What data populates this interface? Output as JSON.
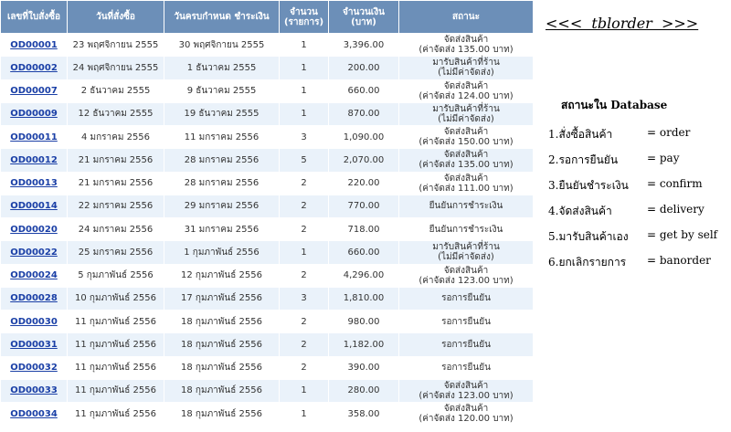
{
  "headers": [
    "เลขที่ใบสั่งซื้อ",
    "วันที่สั่งซื้อ",
    "วันครบกำหนด ชำระเงิน",
    "จำนวน (รายการ)",
    "จำนวนเงิน (บาท)",
    "สถานะ"
  ],
  "rows": [
    {
      "id": "OD00001",
      "order_date": "23 พฤศจิกายน 2555",
      "due_date": "30 พฤศจิกายน 2555",
      "qty": "1",
      "amount": "3,396.00",
      "status": [
        "จัดส่งสินค้า",
        "(ค่าจัดส่ง 135.00 บาท)"
      ]
    },
    {
      "id": "OD00002",
      "order_date": "24 พฤศจิกายน 2555",
      "due_date": "1 ธันวาคม 2555",
      "qty": "1",
      "amount": "200.00",
      "status": [
        "มารับสินค้าที่ร้าน",
        "(ไม่มีค่าจัดส่ง)"
      ]
    },
    {
      "id": "OD00007",
      "order_date": "2 ธันวาคม 2555",
      "due_date": "9 ธันวาคม 2555",
      "qty": "1",
      "amount": "660.00",
      "status": [
        "จัดส่งสินค้า",
        "(ค่าจัดส่ง 124.00 บาท)"
      ]
    },
    {
      "id": "OD00009",
      "order_date": "12 ธันวาคม 2555",
      "due_date": "19 ธันวาคม 2555",
      "qty": "1",
      "amount": "870.00",
      "status": [
        "มารับสินค้าที่ร้าน",
        "(ไม่มีค่าจัดส่ง)"
      ]
    },
    {
      "id": "OD00011",
      "order_date": "4 มกราคม 2556",
      "due_date": "11 มกราคม 2556",
      "qty": "3",
      "amount": "1,090.00",
      "status": [
        "จัดส่งสินค้า",
        "(ค่าจัดส่ง 150.00 บาท)"
      ]
    },
    {
      "id": "OD00012",
      "order_date": "21 มกราคม 2556",
      "due_date": "28 มกราคม 2556",
      "qty": "5",
      "amount": "2,070.00",
      "status": [
        "จัดส่งสินค้า",
        "(ค่าจัดส่ง 135.00 บาท)"
      ]
    },
    {
      "id": "OD00013",
      "order_date": "21 มกราคม 2556",
      "due_date": "28 มกราคม 2556",
      "qty": "2",
      "amount": "220.00",
      "status": [
        "จัดส่งสินค้า",
        "(ค่าจัดส่ง 111.00 บาท)"
      ]
    },
    {
      "id": "OD00014",
      "order_date": "22 มกราคม 2556",
      "due_date": "29 มกราคม 2556",
      "qty": "2",
      "amount": "770.00",
      "status": [
        "ยืนยันการชำระเงิน"
      ]
    },
    {
      "id": "OD00020",
      "order_date": "24 มกราคม 2556",
      "due_date": "31 มกราคม 2556",
      "qty": "2",
      "amount": "718.00",
      "status": [
        "ยืนยันการชำระเงิน"
      ]
    },
    {
      "id": "OD00022",
      "order_date": "25 มกราคม 2556",
      "due_date": "1 กุมภาพันธ์ 2556",
      "qty": "1",
      "amount": "660.00",
      "status": [
        "มารับสินค้าที่ร้าน",
        "(ไม่มีค่าจัดส่ง)"
      ]
    },
    {
      "id": "OD00024",
      "order_date": "5 กุมภาพันธ์ 2556",
      "due_date": "12 กุมภาพันธ์ 2556",
      "qty": "2",
      "amount": "4,296.00",
      "status": [
        "จัดส่งสินค้า",
        "(ค่าจัดส่ง 123.00 บาท)"
      ]
    },
    {
      "id": "OD00028",
      "order_date": "10 กุมภาพันธ์ 2556",
      "due_date": "17 กุมภาพันธ์ 2556",
      "qty": "3",
      "amount": "1,810.00",
      "status": [
        "รอการยืนยัน"
      ]
    },
    {
      "id": "OD00030",
      "order_date": "11 กุมภาพันธ์ 2556",
      "due_date": "18 กุมภาพันธ์ 2556",
      "qty": "2",
      "amount": "980.00",
      "status": [
        "รอการยืนยัน"
      ]
    },
    {
      "id": "OD00031",
      "order_date": "11 กุมภาพันธ์ 2556",
      "due_date": "18 กุมภาพันธ์ 2556",
      "qty": "2",
      "amount": "1,182.00",
      "status": [
        "รอการยืนยัน"
      ]
    },
    {
      "id": "OD00032",
      "order_date": "11 กุมภาพันธ์ 2556",
      "due_date": "18 กุมภาพันธ์ 2556",
      "qty": "2",
      "amount": "390.00",
      "status": [
        "รอการยืนยัน"
      ]
    },
    {
      "id": "OD00033",
      "order_date": "11 กุมภาพันธ์ 2556",
      "due_date": "18 กุมภาพันธ์ 2556",
      "qty": "1",
      "amount": "280.00",
      "status": [
        "จัดส่งสินค้า",
        "(ค่าจัดส่ง 123.00 บาท)"
      ]
    },
    {
      "id": "OD00034",
      "order_date": "11 กุมภาพันธ์ 2556",
      "due_date": "18 กุมภาพันธ์ 2556",
      "qty": "1",
      "amount": "358.00",
      "status": [
        "จัดส่งสินค้า",
        "(ค่าจัดส่ง 120.00 บาท)"
      ]
    }
  ],
  "side": {
    "title": "<<<  tblorder  >>>",
    "db_heading": "สถานะใน Database",
    "items": [
      {
        "label": "1.สั่งซื้อสินค้า",
        "value": "= order"
      },
      {
        "label": "2.รอการยืนยัน",
        "value": "= pay"
      },
      {
        "label": "3.ยืนยันชำระเงิน",
        "value": "= confirm"
      },
      {
        "label": "4.จัดส่งสินค้า",
        "value": "= delivery"
      },
      {
        "label": "5.มารับสินค้าเอง",
        "value": "= get by self"
      },
      {
        "label": "6.ยกเลิกรายการ",
        "value": "= banorder"
      }
    ]
  },
  "colors": {
    "header_bg": "#6c8fb8",
    "row_alt": "#eaf2fa",
    "link": "#1a3fa6"
  }
}
